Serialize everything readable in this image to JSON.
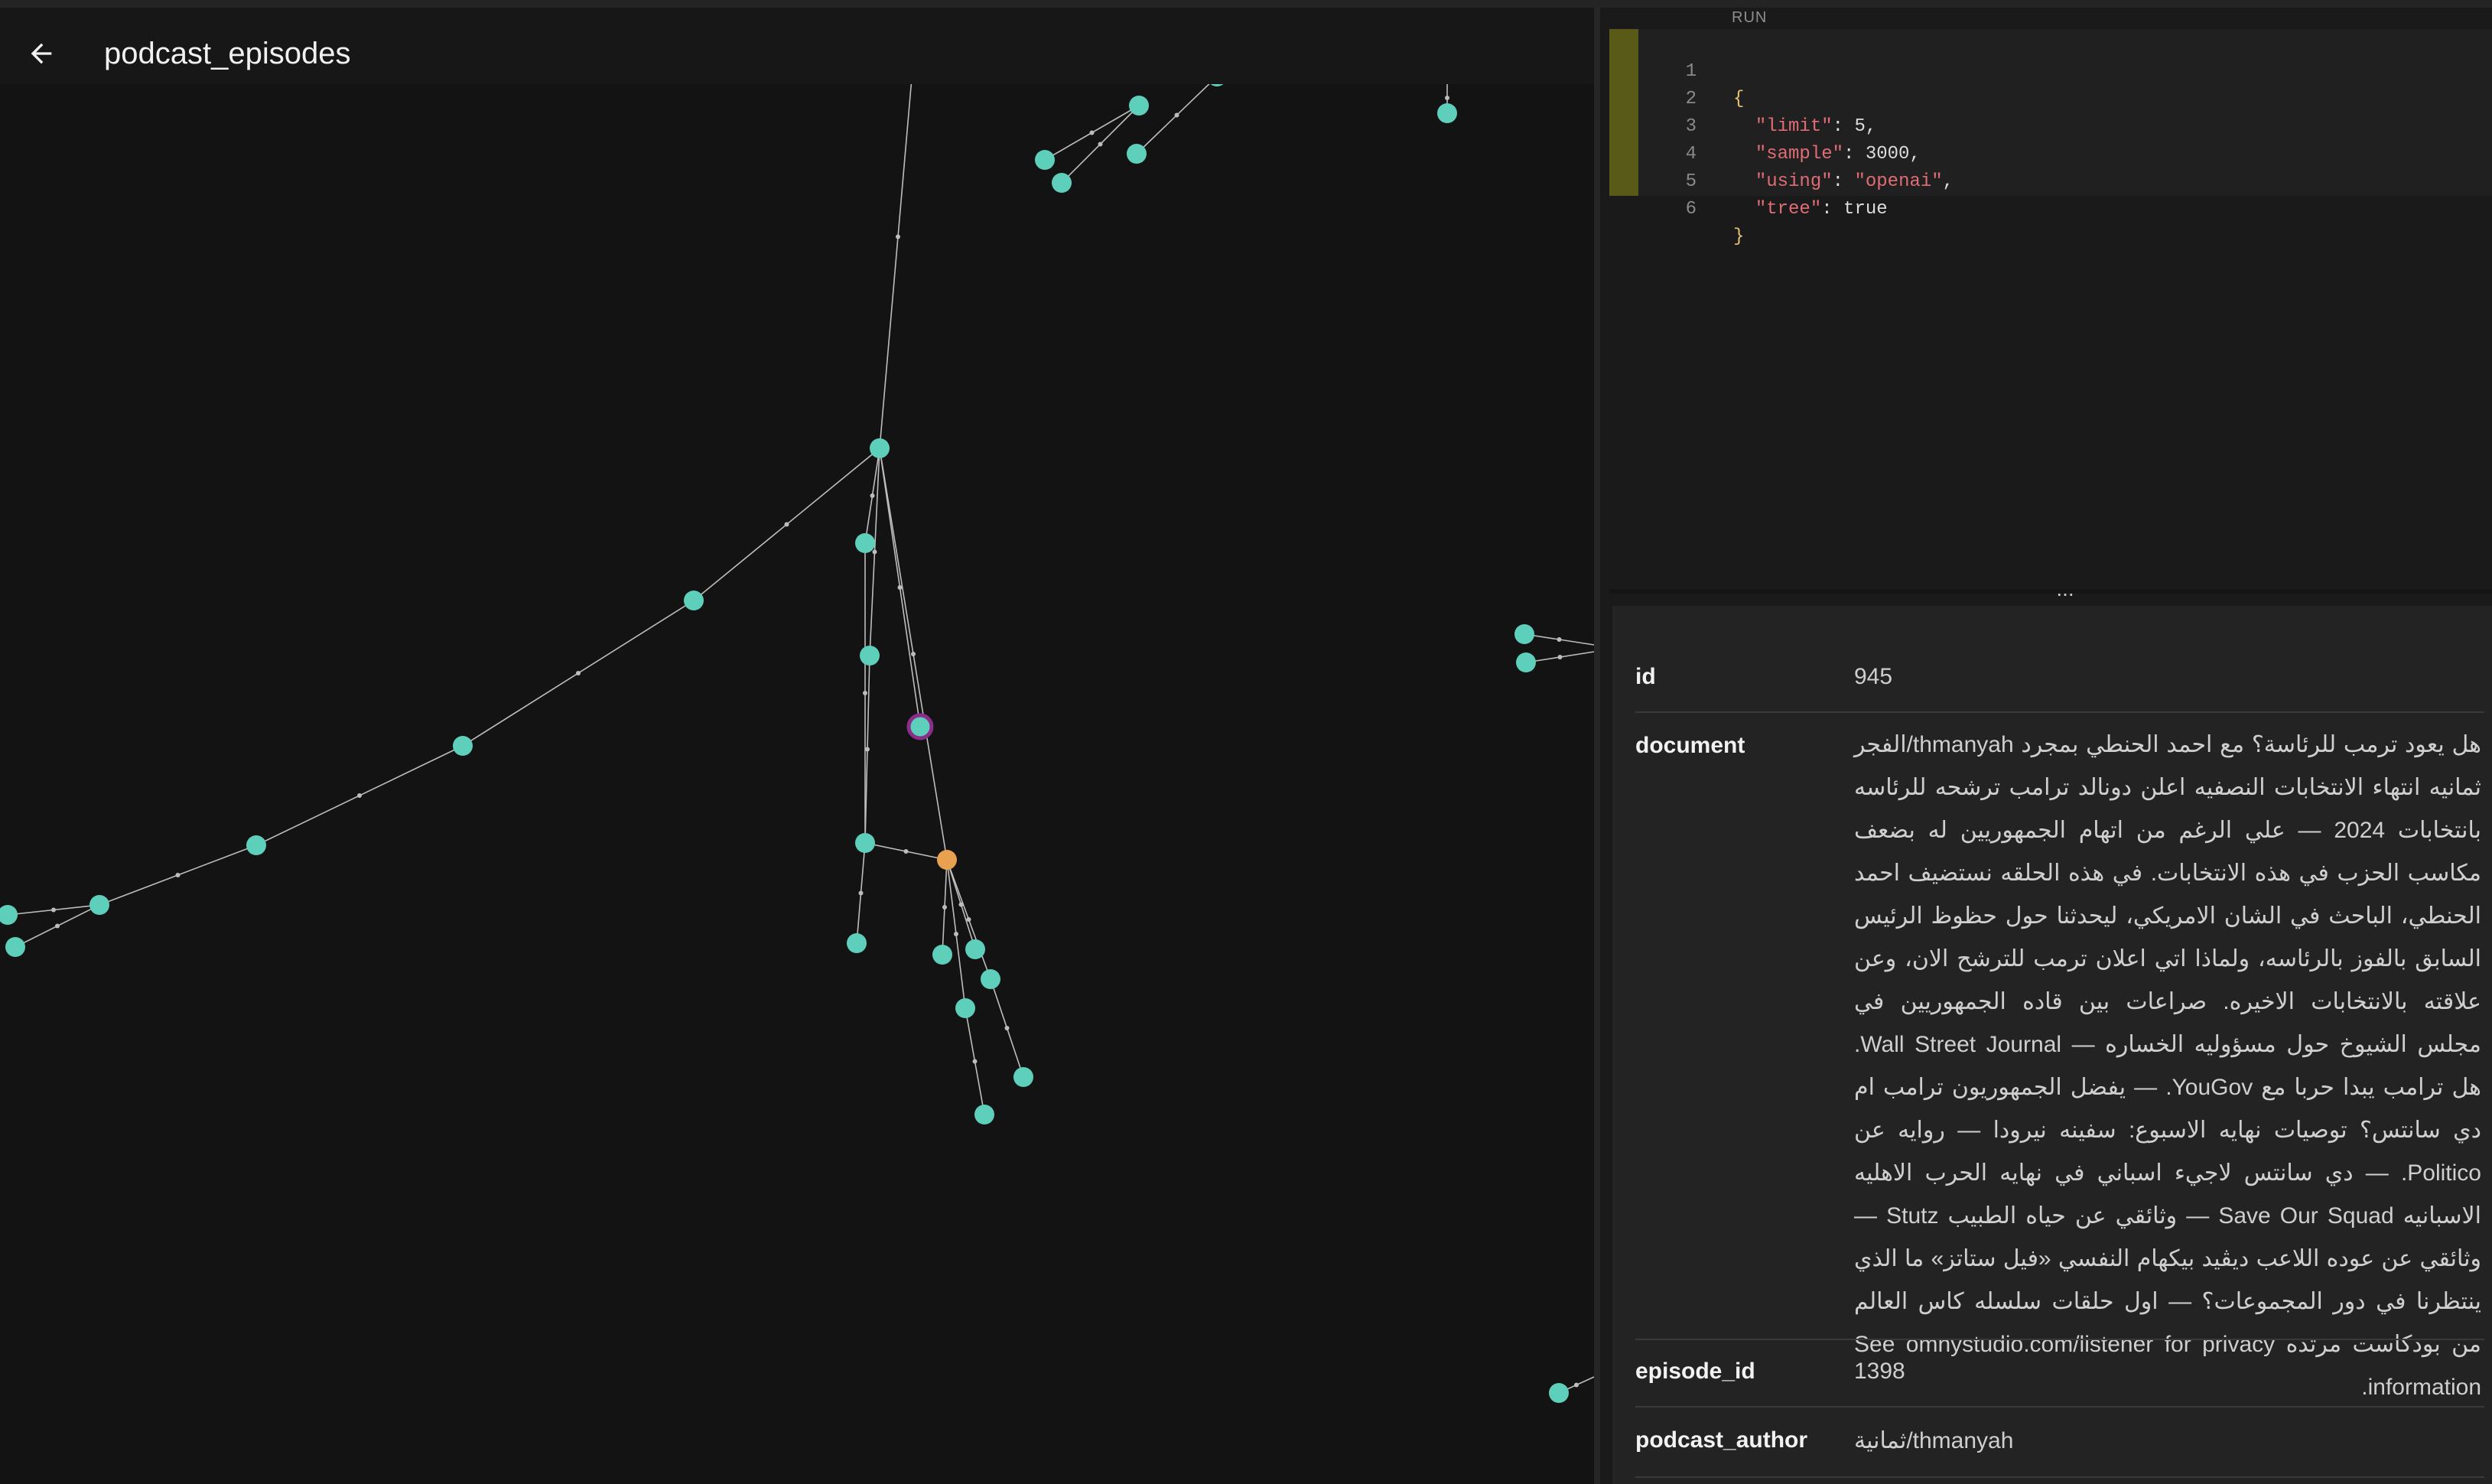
{
  "header": {
    "title": "podcast_episodes",
    "back_icon": "arrow-left-icon"
  },
  "editor": {
    "run_label": "RUN",
    "line_numbers": [
      "1",
      "2",
      "3",
      "4",
      "5",
      "6"
    ],
    "lines": {
      "l1_open": "{",
      "l2_key": "\"limit\"",
      "l2_rest": ": 5,",
      "l3_key": "\"sample\"",
      "l3_rest": ": 3000,",
      "l4_key": "\"using\"",
      "l4_sep": ": ",
      "l4_val": "\"openai\"",
      "l4_end": ",",
      "l5_key": "\"tree\"",
      "l5_rest": ": true",
      "l6_close": "}"
    },
    "query": {
      "limit": 5,
      "sample": 3000,
      "using": "openai",
      "tree": true
    }
  },
  "splitter": {
    "grip": "⋮",
    "handle": "..."
  },
  "details": {
    "id_key": "id",
    "id_value": "945",
    "document_key": "document",
    "document_value": "هل يعود ترمب للرئاسة؟ مع احمد الحنطي بمجرد thmanyah/الفجر ثمانيه انتهاء الانتخابات النصفيه اعلن دونالد ترامب ترشحه للرئاسه بانتخابات 2024 — علي الرغم من اتهام الجمهوريين له بضعف مكاسب الحزب في هذه الانتخابات. في هذه الحلقه نستضيف احمد الحنطي، الباحث في الشان الامريكي، ليحدثنا حول حظوظ الرئيس السابق بالفوز بالرئاسه، ولماذا اتي اعلان ترمب للترشح الان، وعن علاقته بالانتخابات الاخيره. صراعات بين قاده الجمهوريين في مجلس الشيوخ حول مسؤوليه الخساره — Wall Street Journal. هل ترامب يبدا حربا مع YouGov. — يفضل الجمهوريون ترامب ام دي سانتس؟ توصيات نهايه الاسبوع: سفينه نيرودا — روايه عن Politico. — دي سانتس لاجيء اسباني في نهايه الحرب الاهليه الاسبانيه Save Our Squad — وثائقي عن حياه الطبيب Stutz — وثائقي عن عوده اللاعب ديڤيد بيكهام النفسي «فيل ستاتز» ما الذي ينتظرنا في دور المجموعات؟ — اول حلقات سلسله كاس العالم من بودكاست مرتده See omnystudio.com/listener for privacy information.",
    "episode_id_key": "episode_id",
    "episode_id_value": "1398",
    "podcast_author_key": "podcast_author",
    "podcast_author_value": "ثمانية/thmanyah"
  },
  "graph": {
    "node_color": "#5ecfba",
    "selected_ring_color": "#8a2e8a",
    "focus_node_color": "#e8a24f",
    "edge_color": "#bdbdbd"
  }
}
